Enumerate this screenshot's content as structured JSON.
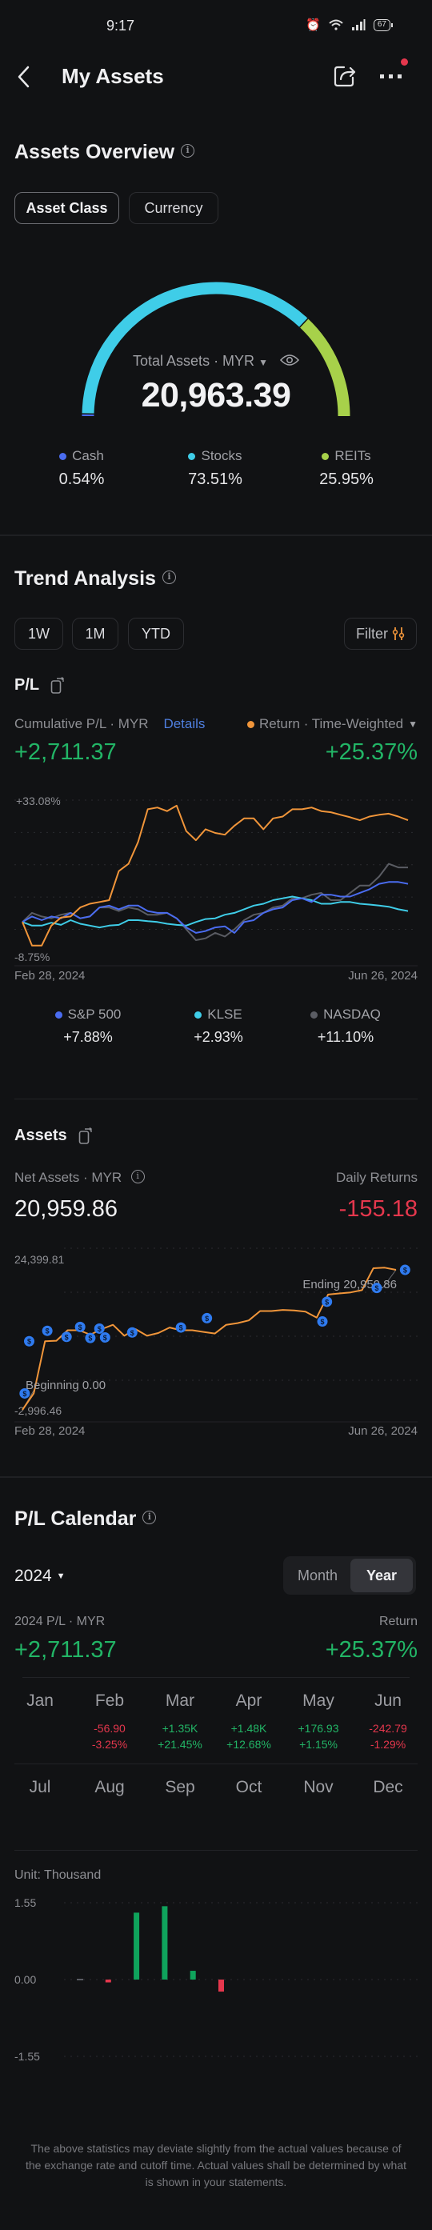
{
  "status_bar": {
    "time": "9:17",
    "battery": "67"
  },
  "header": {
    "title": "My Assets"
  },
  "overview": {
    "title": "Assets Overview",
    "tabs": [
      {
        "label": "Asset Class",
        "active": true
      },
      {
        "label": "Currency",
        "active": false
      }
    ],
    "total_label": "Total Assets · MYR",
    "total_value": "20,963.39",
    "allocation": [
      {
        "name": "Cash",
        "percent": 0.54,
        "display": "0.54%",
        "color": "#4a6cf0"
      },
      {
        "name": "Stocks",
        "percent": 73.51,
        "display": "73.51%",
        "color": "#3fcde8"
      },
      {
        "name": "REITs",
        "percent": 25.95,
        "display": "25.95%",
        "color": "#a7d14a"
      }
    ]
  },
  "trend": {
    "title": "Trend Analysis",
    "periods": [
      "1W",
      "1M",
      "YTD"
    ],
    "filter_label": "Filter",
    "pl_title": "P/L",
    "cumulative_label": "Cumulative P/L · MYR",
    "details_link": "Details",
    "return_selector": "Return · Time-Weighted",
    "cumulative_value": "+2,711.37",
    "return_value": "+25.37%",
    "benchmarks": [
      {
        "name": "S&P 500",
        "value": "+7.88%",
        "color": "#4a6cf0"
      },
      {
        "name": "KLSE",
        "value": "+2.93%",
        "color": "#3fcde8"
      },
      {
        "name": "NASDAQ",
        "value": "+11.10%",
        "color": "#5a5c63"
      }
    ]
  },
  "assets": {
    "title": "Assets",
    "net_label": "Net Assets · MYR",
    "net_value": "20,959.86",
    "daily_label": "Daily Returns",
    "daily_value": "-155.18"
  },
  "calendar": {
    "title": "P/L Calendar",
    "year": "2024",
    "toggle": [
      {
        "label": "Month",
        "active": false
      },
      {
        "label": "Year",
        "active": true
      }
    ],
    "pl_label": "2024 P/L · MYR",
    "return_label": "Return",
    "pl_value": "+2,711.37",
    "return_value": "+25.37%",
    "months": [
      {
        "name": "Jan",
        "pl": "",
        "ret": "",
        "dir": ""
      },
      {
        "name": "Feb",
        "pl": "-56.90",
        "ret": "-3.25%",
        "dir": "neg"
      },
      {
        "name": "Mar",
        "pl": "+1.35K",
        "ret": "+21.45%",
        "dir": "pos"
      },
      {
        "name": "Apr",
        "pl": "+1.48K",
        "ret": "+12.68%",
        "dir": "pos"
      },
      {
        "name": "May",
        "pl": "+176.93",
        "ret": "+1.15%",
        "dir": "pos"
      },
      {
        "name": "Jun",
        "pl": "-242.79",
        "ret": "-1.29%",
        "dir": "neg"
      },
      {
        "name": "Jul",
        "pl": "",
        "ret": "",
        "dir": ""
      },
      {
        "name": "Aug",
        "pl": "",
        "ret": "",
        "dir": ""
      },
      {
        "name": "Sep",
        "pl": "",
        "ret": "",
        "dir": ""
      },
      {
        "name": "Oct",
        "pl": "",
        "ret": "",
        "dir": ""
      },
      {
        "name": "Nov",
        "pl": "",
        "ret": "",
        "dir": ""
      },
      {
        "name": "Dec",
        "pl": "",
        "ret": "",
        "dir": ""
      }
    ],
    "unit_label": "Unit: Thousand"
  },
  "footer_note": "The above statistics may deviate slightly from the actual values because of the exchange rate and cutoff time. Actual values shall be determined by what is shown in your statements.",
  "chart_data": [
    {
      "type": "pie",
      "title": "Total Assets · MYR",
      "categories": [
        "Cash",
        "Stocks",
        "REITs"
      ],
      "values": [
        0.54,
        73.51,
        25.95
      ],
      "colors": [
        "#4a6cf0",
        "#3fcde8",
        "#a7d14a"
      ]
    },
    {
      "type": "line",
      "title": "P/L",
      "ylim": [
        -8.75,
        33.08
      ],
      "ytick_labels": [
        "+33.08%",
        "-8.75%"
      ],
      "x_start_label": "Feb 28, 2024",
      "x_end_label": "Jun 26, 2024",
      "grid": true,
      "x": [
        0,
        1,
        2,
        3,
        4,
        5,
        6,
        7,
        8,
        9,
        10,
        11,
        12,
        13,
        14,
        15,
        16,
        17,
        18,
        19,
        20,
        21,
        22,
        23,
        24,
        25,
        26,
        27,
        28,
        29,
        30,
        31,
        32,
        33,
        34,
        35,
        36,
        37,
        38,
        39,
        40
      ],
      "series": [
        {
          "name": "Return · Time-Weighted",
          "color": "#f0953a",
          "values": [
            0,
            -6.5,
            -6.5,
            -1,
            1.2,
            1.5,
            4,
            5,
            5.5,
            6,
            14,
            16,
            22,
            31,
            31.5,
            30.5,
            32,
            25,
            22.5,
            25.5,
            24.5,
            24,
            26.5,
            28.5,
            28.5,
            25.5,
            28.5,
            29,
            31,
            31,
            31.5,
            30.5,
            30.2,
            29.5,
            28.8,
            28,
            29,
            29.5,
            29.8,
            29,
            28
          ]
        },
        {
          "name": "S&P 500",
          "color": "#4a6cf0",
          "values": [
            0,
            1.5,
            0.5,
            1.5,
            1,
            2.5,
            1,
            1.5,
            4,
            4.5,
            3.5,
            4.5,
            4.5,
            3,
            2.5,
            2.5,
            1,
            -1.5,
            -3,
            -2.5,
            -1.5,
            -1.2,
            -3,
            0,
            0.5,
            2.5,
            3.5,
            4,
            6,
            6.5,
            5.5,
            7.5,
            7.5,
            7,
            7,
            8,
            9,
            10.5,
            11,
            11,
            10.5
          ]
        },
        {
          "name": "KLSE",
          "color": "#3fcde8",
          "values": [
            0,
            -1,
            -1,
            -0.2,
            -0.8,
            0.5,
            -0.5,
            -1,
            -1.5,
            -1,
            -0.8,
            0.5,
            0.5,
            0.2,
            0,
            -0.5,
            -0.8,
            -1,
            0,
            0.8,
            1,
            2,
            2.5,
            3.5,
            4.5,
            5,
            6,
            6.5,
            7,
            6.5,
            6,
            5,
            5,
            5.5,
            5.5,
            5,
            4.8,
            4.5,
            4.2,
            3.5,
            3
          ]
        },
        {
          "name": "NASDAQ",
          "color": "#5a5c63",
          "values": [
            0,
            2.5,
            1.5,
            1,
            2,
            2.5,
            1,
            1.5,
            4,
            4,
            3,
            4,
            3.5,
            2,
            2,
            2.5,
            1,
            -2,
            -5,
            -4.5,
            -3,
            -4,
            -2,
            0.5,
            2,
            2.5,
            4,
            4.5,
            6.5,
            6.5,
            7.5,
            8,
            6,
            6,
            8,
            10,
            10,
            12.5,
            16,
            15,
            15
          ]
        }
      ]
    },
    {
      "type": "line",
      "title": "Assets",
      "ylim": [
        -2996.46,
        24399.81
      ],
      "ytick_labels": [
        "24,399.81",
        "-2,996.46"
      ],
      "x_start_label": "Feb 28, 2024",
      "x_end_label": "Jun 26, 2024",
      "annotations": [
        "Beginning 0.00",
        "Ending 20,959.86"
      ],
      "grid": true,
      "x": [
        0,
        1,
        2,
        3,
        4,
        5,
        6,
        7,
        8,
        9,
        10,
        11,
        12,
        13,
        14,
        15,
        16,
        17,
        18,
        19,
        20,
        21,
        22,
        23,
        24,
        25,
        26,
        27,
        28,
        29,
        30,
        31,
        32,
        33
      ],
      "series": [
        {
          "name": "Net Assets",
          "color": "#f0953a",
          "values": [
            -3000,
            0,
            9500,
            9600,
            11500,
            11500,
            10700,
            11700,
            12500,
            10500,
            11700,
            10500,
            11000,
            12000,
            11500,
            11500,
            11200,
            10900,
            12500,
            12800,
            13300,
            15000,
            15000,
            15200,
            15100,
            14900,
            13800,
            18000,
            18200,
            18400,
            18800,
            22800,
            22900,
            22500
          ]
        },
        {
          "name": "Deposits",
          "type": "scatter",
          "marker": "$",
          "x_points": [
            0.2,
            0.6,
            2.2,
            3.9,
            5.1,
            6,
            6.8,
            7.3,
            9.7,
            14,
            16.3,
            26.5,
            26.9,
            31.3,
            33.8
          ],
          "values": [
            0,
            9500,
            11400,
            10300,
            12100,
            10100,
            11800,
            10200,
            11100,
            12000,
            13700,
            13100,
            16700,
            19200,
            22500
          ]
        }
      ]
    },
    {
      "type": "bar",
      "title": "P/L Calendar",
      "ylabel": "Unit: Thousand",
      "categories": [
        "Jan",
        "Feb",
        "Mar",
        "Apr",
        "May",
        "Jun",
        "Jul",
        "Aug",
        "Sep",
        "Oct",
        "Nov",
        "Dec"
      ],
      "values": [
        0,
        -0.057,
        1.35,
        1.48,
        0.177,
        -0.243,
        null,
        null,
        null,
        null,
        null,
        null
      ],
      "ylim": [
        -1.55,
        1.55
      ],
      "ytick_labels": [
        "1.55",
        "0.00",
        "-1.55"
      ],
      "colors": {
        "positive": "#0fa35c",
        "negative": "#e5374d",
        "zero": "#5a5c63"
      }
    }
  ]
}
